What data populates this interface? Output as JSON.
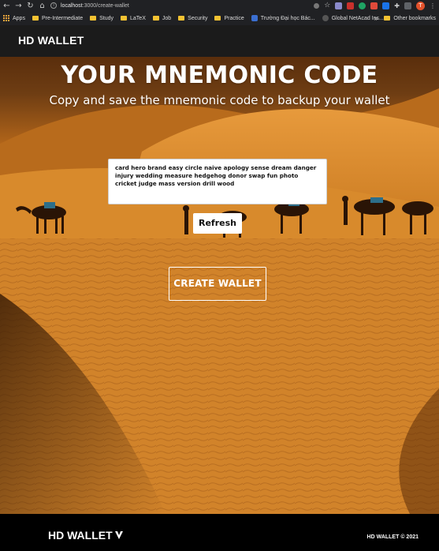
{
  "browser": {
    "url_host": "localhost",
    "url_path": ":3000/create-wallet",
    "bookmarks": [
      {
        "label": "Apps",
        "icon": "apps-grid-icon"
      },
      {
        "label": "Pre-Intermediate",
        "icon": "folder-icon"
      },
      {
        "label": "Study",
        "icon": "folder-icon"
      },
      {
        "label": "LaTeX",
        "icon": "folder-icon"
      },
      {
        "label": "Job",
        "icon": "folder-icon"
      },
      {
        "label": "Security",
        "icon": "folder-icon"
      },
      {
        "label": "Practice",
        "icon": "folder-icon"
      },
      {
        "label": "Trường Đại học Bác...",
        "icon": "school-icon"
      },
      {
        "label": "Global NetAcad Ins...",
        "icon": "globe-icon"
      }
    ],
    "other_bookmarks": "Other bookmarks",
    "overflow": "»",
    "profile_initial": "T"
  },
  "navbar": {
    "brand": "HD WALLET"
  },
  "hero": {
    "title": "YOUR MNEMONIC CODE",
    "subtitle": "Copy and save the mnemonic code to backup your wallet",
    "mnemonic": "card hero brand easy circle naive apology sense dream danger injury wedding measure hedgehog donor swap fun photo cricket judge mass version drill wood",
    "refresh_label": "Refresh",
    "create_label": "CREATE WALLET"
  },
  "footer": {
    "brand": "HD WALLET",
    "copyright": "HD WALLET © 2021"
  },
  "colors": {
    "navbar_bg": "#1b1b1b",
    "footer_bg": "#000000",
    "sand": "#d98a2b"
  }
}
